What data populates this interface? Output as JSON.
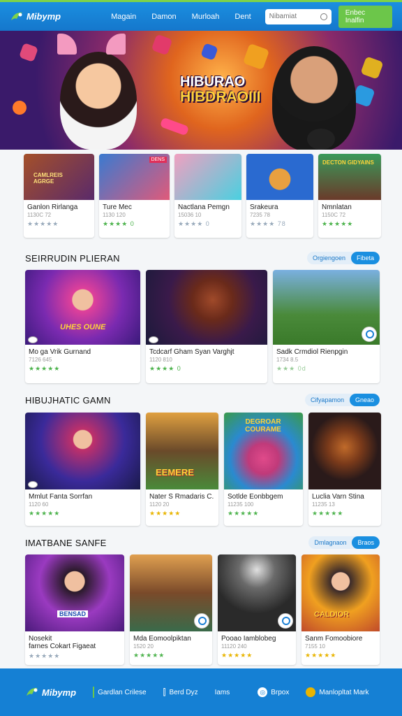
{
  "nav": {
    "brand": "Mibymp",
    "links": [
      "Magain",
      "Damon",
      "Murloah",
      "Dent"
    ],
    "search_placeholder": "Nibamiat",
    "signup": "Enbec Inalfin"
  },
  "hero": {
    "line1": "HIBURAO",
    "line2": "HIBDRAOIII"
  },
  "top_row": [
    {
      "title": "Ganlon Rirlanga",
      "meta": "1130C 72",
      "stars": "★★★★★",
      "tag": "CAMLREIS AGRGE"
    },
    {
      "title": "Ture Mec",
      "meta": "1130 120",
      "stars": "★★★★ 0",
      "badge": "DENS"
    },
    {
      "title": "Nactlana Pemgn",
      "meta": "15036 10",
      "stars": "★★★★ 0"
    },
    {
      "title": "Srakeura",
      "meta": "7235 78",
      "stars": "★★★★ 78"
    },
    {
      "title": "Nmnlatan",
      "meta": "1150C 72",
      "stars": "★★★★★",
      "tag": "DECTON GIDYAINS"
    }
  ],
  "sections": [
    {
      "heading": "SEIRRUDIN PLIERAN",
      "toggle": [
        "Orgiengoen",
        "Fibeta"
      ],
      "cards": [
        {
          "title": "Mo ga Vrik Gurnand",
          "meta": "7126 645",
          "stars": "★★★★★",
          "tag": "UHES OUNE"
        },
        {
          "title": "Tcdcarf Gham Syan Varghjt",
          "meta": "1120 810",
          "stars": "★★★★ 0"
        },
        {
          "title": "Sadk Crmdiol Rienpgin",
          "meta": "1734 8.5",
          "stars": "★★★ 0d"
        }
      ]
    },
    {
      "heading": "HIBUJHATIC GAMN",
      "toggle": [
        "Cifyapamon",
        "Gneao"
      ],
      "cards": [
        {
          "title": "Mmlut Fanta Sorrfan",
          "meta": "1120 60",
          "stars": "★★★★★"
        },
        {
          "title": "Nater S Rmadaris C.",
          "meta": "1120 20",
          "stars": "★★★★★",
          "tag": "EEMERE"
        },
        {
          "title": "Sotlde Eonbbgem",
          "meta": "11235 100",
          "stars": "★★★★★",
          "tag": "DEGROAR COURAME"
        },
        {
          "title": "Luclia Varn Stina",
          "meta": "11235 13",
          "stars": "★★★★★"
        }
      ]
    },
    {
      "heading": "IMATBANE SANFE",
      "toggle": [
        "Dmlagnaon",
        "Braos"
      ],
      "cards": [
        {
          "title": "Nosekit\nfarnes Cokart Figaeat",
          "meta": "",
          "stars": "★★★★★",
          "tag": "BENSAD"
        },
        {
          "title": "Mda Eomoolpiktan",
          "meta": "1520 20",
          "stars": "★★★★★"
        },
        {
          "title": "Pooao Iamblobeg",
          "meta": "11120 240",
          "stars": "★★★★★"
        },
        {
          "title": "Sanm Fomoobiore",
          "meta": "7155 10",
          "stars": "★★★★★",
          "tag": "CALDIOR"
        }
      ]
    }
  ],
  "footer": {
    "brand": "Mibymp",
    "links": [
      "Gardlan Crilese",
      "Berd Dyz",
      "Iams",
      "Brpox",
      "Manlopltat Mark"
    ]
  },
  "colors": {
    "primary": "#1580d4",
    "accent": "#6cc64a",
    "star_green": "#4db34d",
    "star_gold": "#e8b400"
  }
}
